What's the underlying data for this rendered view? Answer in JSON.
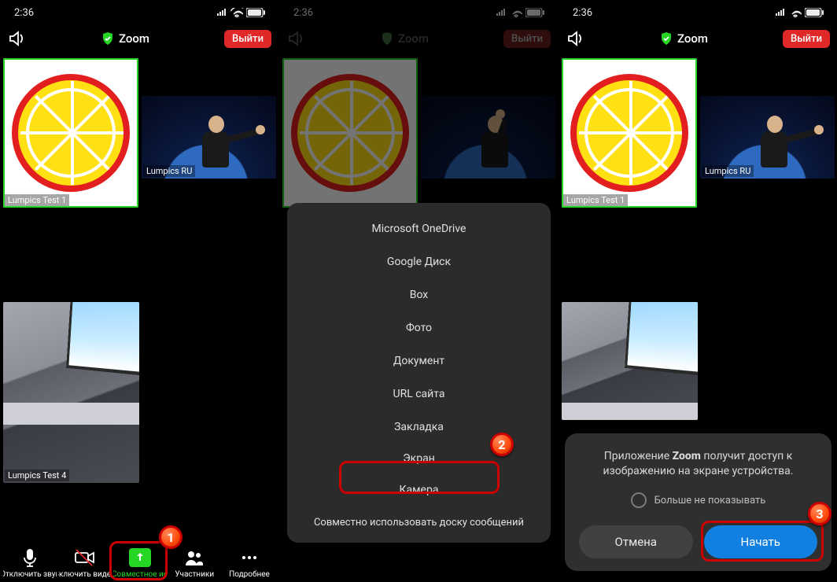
{
  "status": {
    "time": "2:36"
  },
  "topbar": {
    "app": "Zoom",
    "leave": "Выйти"
  },
  "participants": {
    "main": "Lumpics Test 1",
    "second": "Lumpics RU",
    "third": "Lumpics Test 4"
  },
  "toolbar": {
    "mute": "Отключить звук",
    "video": "Включить видео",
    "share": "Совместное ис",
    "participants": "Участники",
    "more": "Подробнее"
  },
  "sheet": {
    "onedrive": "Microsoft OneDrive",
    "gdrive": "Google Диск",
    "box": "Box",
    "photo": "Фото",
    "document": "Документ",
    "url": "URL сайта",
    "bookmark": "Закладка",
    "screen": "Экран",
    "camera": "Камера",
    "whiteboard": "Совместно использовать доску сообщений"
  },
  "perm": {
    "msg_pre": "Приложение ",
    "msg_app": "Zoom",
    "msg_post": " получит доступ к изображению на экране устройства.",
    "dont_show": "Больше не показывать",
    "cancel": "Отмена",
    "start": "Начать"
  },
  "markers": {
    "m1": "1",
    "m2": "2",
    "m3": "3"
  }
}
